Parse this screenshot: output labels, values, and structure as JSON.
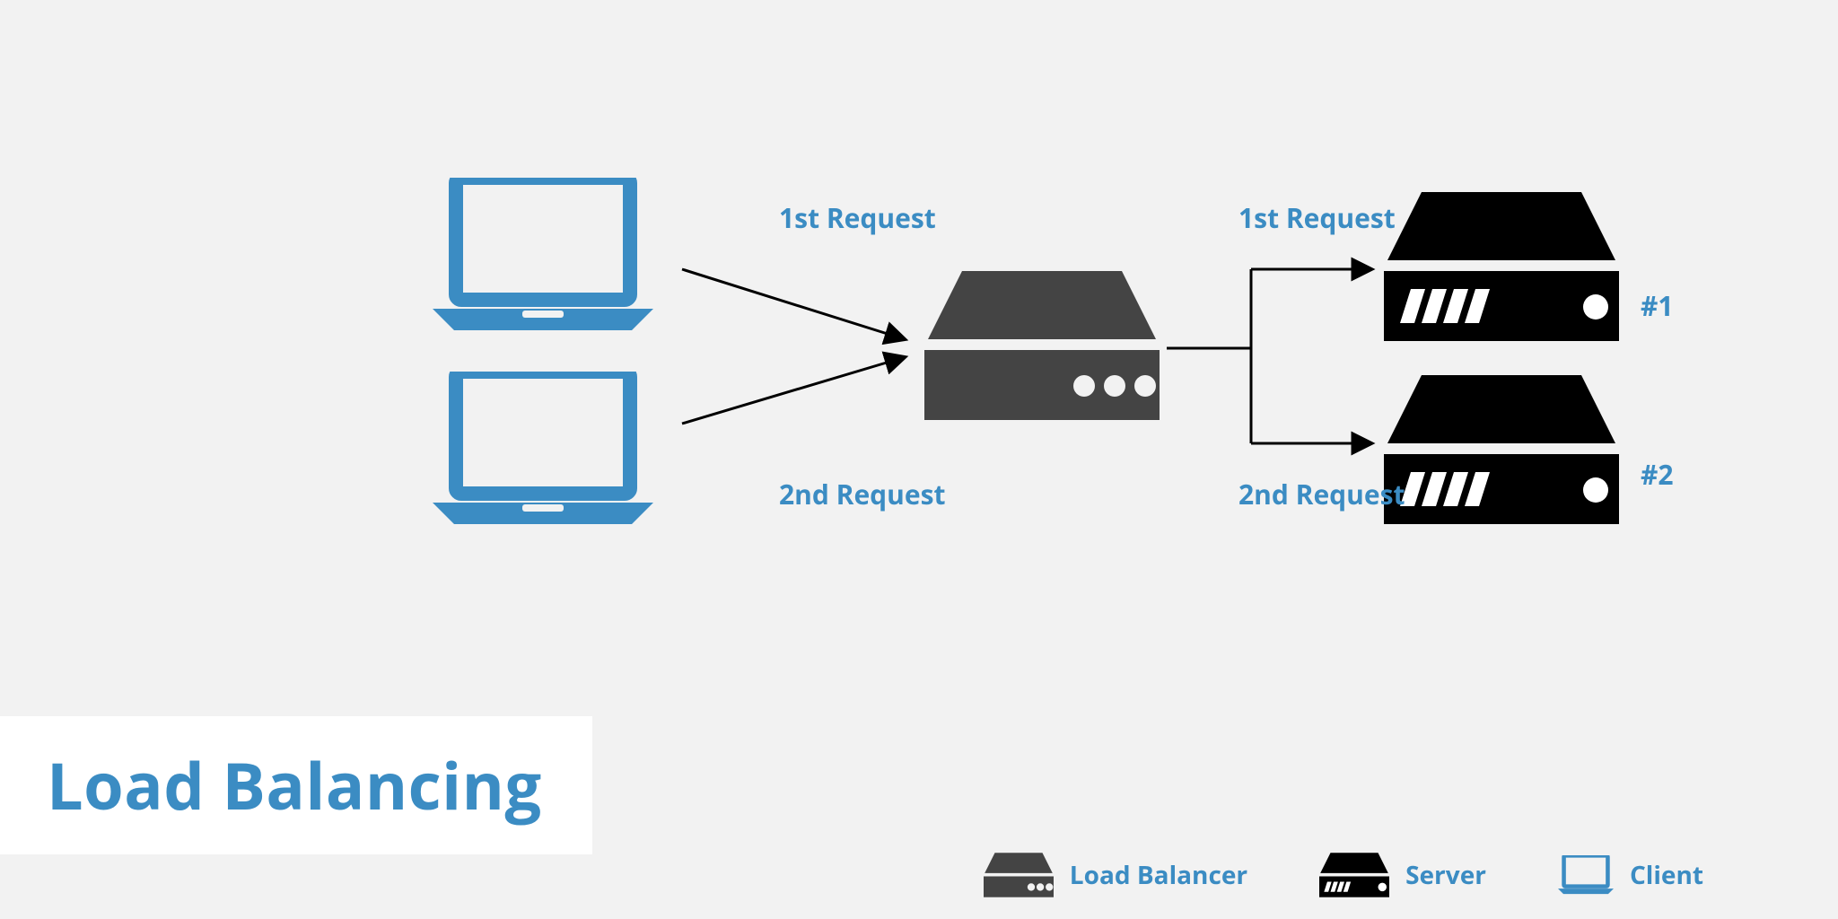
{
  "title": "Load Balancing",
  "labels": {
    "req1_left": "1st Request",
    "req2_left": "2nd Request",
    "req1_right": "1st Request",
    "req2_right": "2nd Request",
    "server1": "#1",
    "server2": "#2"
  },
  "legend": {
    "load_balancer": "Load Balancer",
    "server": "Server",
    "client": "Client"
  },
  "colors": {
    "blue": "#3b8cc3",
    "dark": "#444444",
    "black": "#000000",
    "bg": "#f2f2f2"
  }
}
